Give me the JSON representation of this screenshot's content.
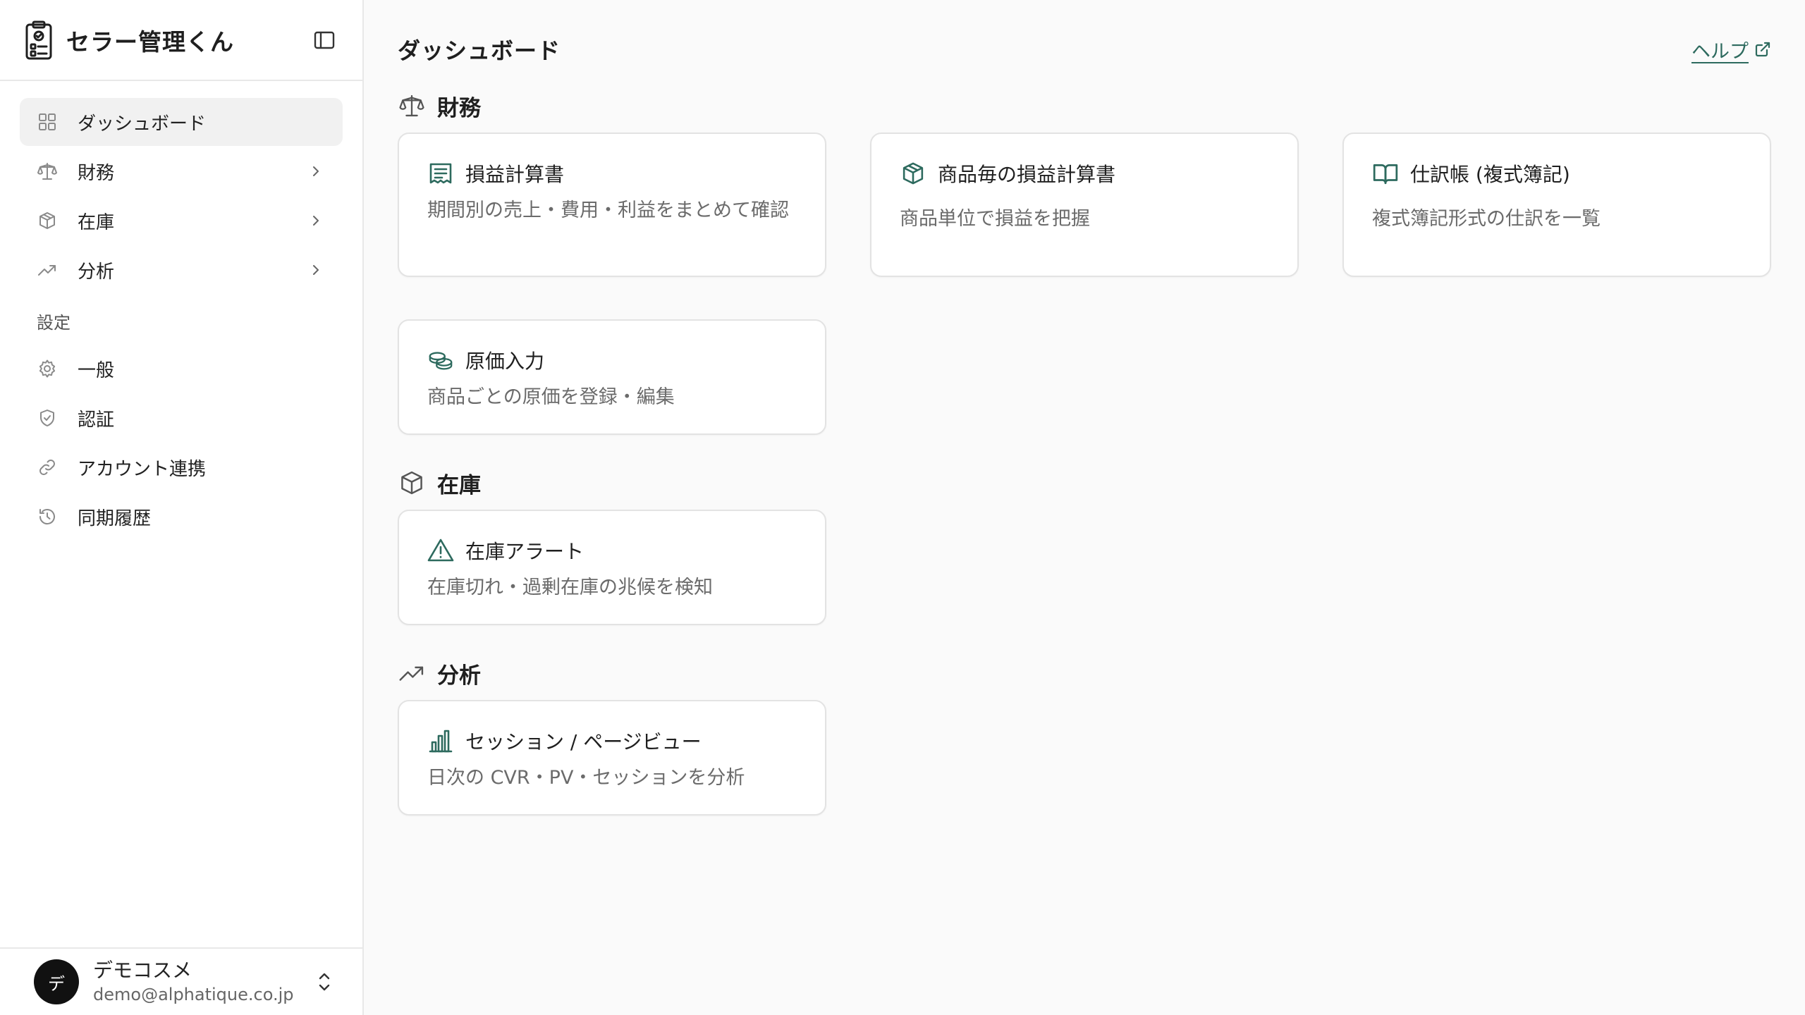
{
  "brand": {
    "title": "セラー管理くん"
  },
  "sidebar": {
    "items": [
      {
        "label": "ダッシュボード",
        "icon": "grid-icon",
        "active": true
      },
      {
        "label": "財務",
        "icon": "scale-icon",
        "has_chevron": true
      },
      {
        "label": "在庫",
        "icon": "box-icon",
        "has_chevron": true
      },
      {
        "label": "分析",
        "icon": "trend-icon",
        "has_chevron": true
      }
    ],
    "settings_label": "設定",
    "settings_items": [
      {
        "label": "一般",
        "icon": "gear-icon"
      },
      {
        "label": "認証",
        "icon": "shield-icon"
      },
      {
        "label": "アカウント連携",
        "icon": "link-icon"
      },
      {
        "label": "同期履歴",
        "icon": "history-icon"
      }
    ]
  },
  "user": {
    "avatar_initial": "デ",
    "name": "デモコスメ",
    "email": "demo@alphatique.co.jp"
  },
  "header": {
    "title": "ダッシュボード",
    "help_label": "ヘルプ"
  },
  "sections": {
    "finance": {
      "title": "財務",
      "cards": [
        {
          "title": "損益計算書",
          "desc": "期間別の売上・費用・利益をまとめて確認",
          "icon": "receipt-icon"
        },
        {
          "title": "商品毎の損益計算書",
          "desc": "商品単位で損益を把握",
          "icon": "package-icon"
        },
        {
          "title": "仕訳帳 (複式簿記)",
          "desc": "複式簿記形式の仕訳を一覧",
          "icon": "book-icon"
        },
        {
          "title": "原価入力",
          "desc": "商品ごとの原価を登録・編集",
          "icon": "coins-icon"
        }
      ]
    },
    "inventory": {
      "title": "在庫",
      "cards": [
        {
          "title": "在庫アラート",
          "desc": "在庫切れ・過剰在庫の兆候を検知",
          "icon": "alert-icon"
        }
      ]
    },
    "analytics": {
      "title": "分析",
      "cards": [
        {
          "title": "セッション / ページビュー",
          "desc": "日次の CVR・PV・セッションを分析",
          "icon": "bar-chart-icon"
        }
      ]
    }
  },
  "colors": {
    "accent": "#2d6a5e",
    "icon_gray": "#8a8a8a",
    "active_bg": "#f1f1f1",
    "avatar_bg": "#111111"
  }
}
